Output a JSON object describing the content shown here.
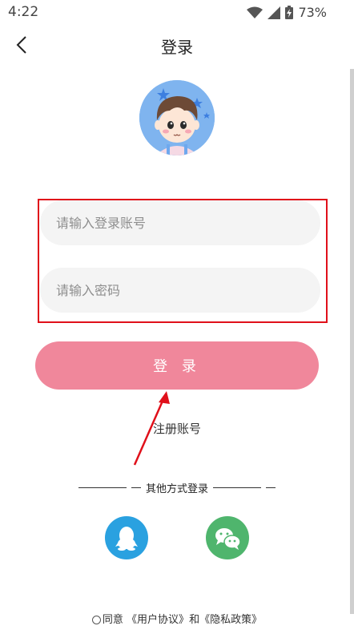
{
  "status_bar": {
    "time": "4:22",
    "battery": "73%"
  },
  "header": {
    "title": "登录"
  },
  "form": {
    "account_placeholder": "请输入登录账号",
    "password_placeholder": "请输入密码",
    "login_label": "登 录"
  },
  "register_label": "注册账号",
  "other_login": {
    "label": "其他方式登录"
  },
  "agreement": {
    "agree_label": "同意",
    "user_agreement": "《用户协议》",
    "and": "和",
    "privacy_policy": "《隐私政策》"
  },
  "colors": {
    "login_button": "#f0879b",
    "highlight_box": "#e0101a",
    "qq": "#2aa1e0",
    "wechat": "#4fb56d"
  }
}
